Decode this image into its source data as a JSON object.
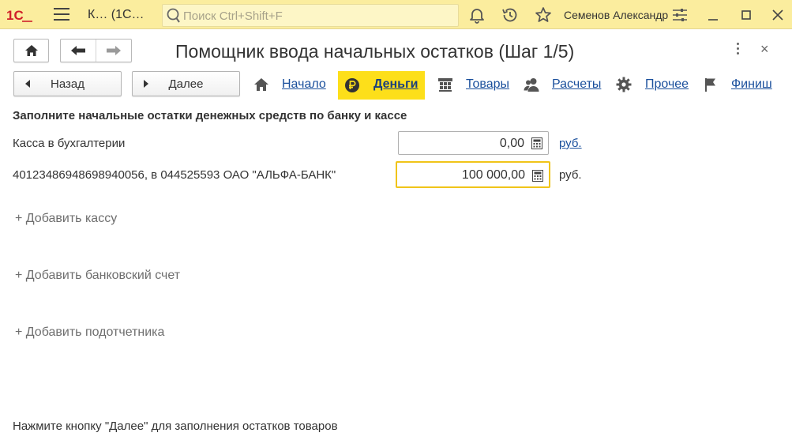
{
  "topbar": {
    "logo_text": "1С",
    "app_title": "К… (1С…",
    "search_placeholder": "Поиск Ctrl+Shift+F",
    "search_value": "",
    "user_name": "Семенов Александр",
    "colors": {
      "bar": "#fbed9e",
      "logo": "#d0202a"
    }
  },
  "form": {
    "title": "Помощник ввода начальных остатков (Шаг 1/5)",
    "close_symbol": "×"
  },
  "steps": {
    "back_label": "Назад",
    "next_label": "Далее",
    "items": [
      {
        "label": "Начало",
        "icon": "home-icon",
        "active": false
      },
      {
        "label": "Деньги",
        "icon": "ruble-coin-icon",
        "active": true
      },
      {
        "label": "Товары",
        "icon": "goods-grid-icon",
        "active": false
      },
      {
        "label": "Расчеты",
        "icon": "people-icon",
        "active": false
      },
      {
        "label": "Прочее",
        "icon": "gear-icon",
        "active": false
      },
      {
        "label": "Финиш",
        "icon": "flag-icon",
        "active": false
      }
    ],
    "active_color": "#fddf1a"
  },
  "content": {
    "heading": "Заполните начальные остатки денежных средств по банку и кассе",
    "rows": [
      {
        "label": "Касса в бухгалтерии",
        "value": "0,00",
        "currency": "руб."
      },
      {
        "label": "40123486948698940056, в 044525593 ОАО \"АЛЬФА-БАНК\"",
        "value": "100 000,00",
        "currency": "руб."
      }
    ],
    "add_cash": "+ Добавить кассу",
    "add_bank": "+ Добавить банковский счет",
    "add_person": "+ Добавить подотчетника",
    "footer": "Нажмите кнопку \"Далее\" для заполнения остатков товаров"
  }
}
